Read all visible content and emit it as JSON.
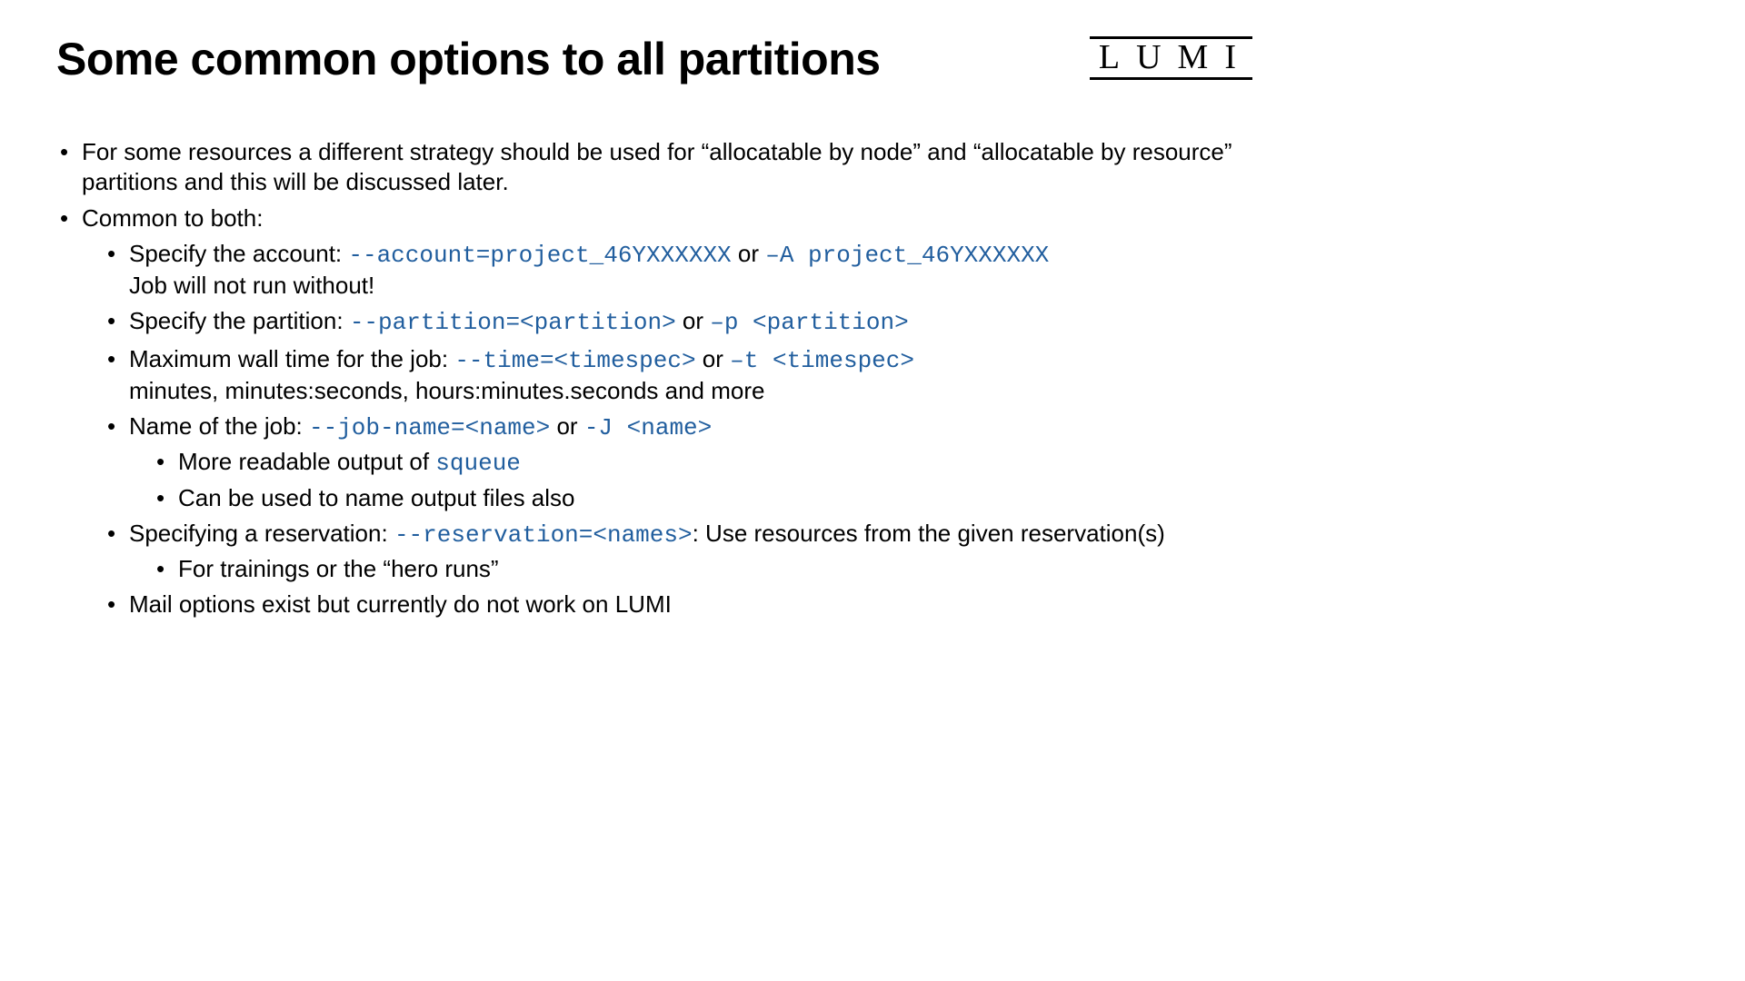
{
  "title": "Some common options to all partitions",
  "logo": "LUMI",
  "b1": {
    "text": "For some resources a different strategy should be used for “allocatable by node” and “allocatable by resource” partitions and this will be discussed later."
  },
  "b2": {
    "text": "Common to both:",
    "s1": {
      "pre": "Specify the account: ",
      "code1": "--account=project_46YXXXXXX",
      "mid": " or ",
      "code2": "–A project_46YXXXXXX",
      "cont": "Job will not run without!"
    },
    "s2": {
      "pre": "Specify the partition: ",
      "code1": "--partition=<partition>",
      "mid": " or ",
      "code2": "–p <partition>"
    },
    "s3": {
      "pre": "Maximum wall time for the job: ",
      "code1": "--time=<timespec>",
      "mid": " or ",
      "code2": "–t <timespec>",
      "cont": "minutes, minutes:seconds, hours:minutes.seconds and more"
    },
    "s4": {
      "pre": "Name of the job: ",
      "code1": "--job-name=<name>",
      "mid": " or ",
      "code2": "-J <name>",
      "ss1": {
        "pre": "More readable output of ",
        "code1": "squeue"
      },
      "ss2": {
        "text": "Can be used to name output files also"
      }
    },
    "s5": {
      "pre": "Specifying a reservation: ",
      "code1": "--reservation=<names>",
      "post": ": Use resources from the given reservation(s)",
      "ss1": {
        "text": "For trainings or the “hero runs”"
      }
    },
    "s6": {
      "text": "Mail options exist but currently do not work on LUMI"
    }
  }
}
